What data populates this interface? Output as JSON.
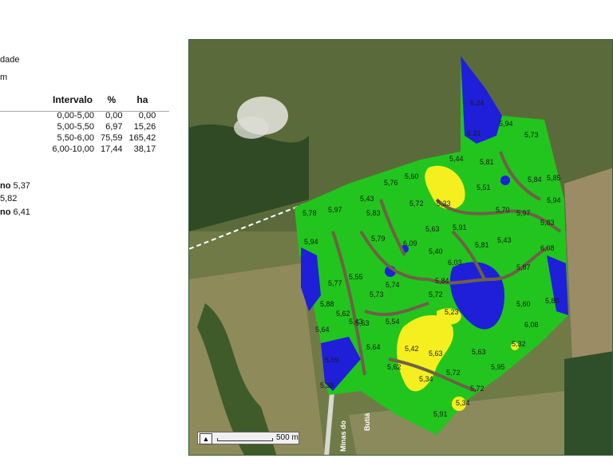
{
  "header": {
    "title_fragment": "dade",
    "unit_fragment": "m"
  },
  "legend": {
    "columns": [
      "Intervalo",
      "%",
      "ha"
    ],
    "rows": [
      {
        "intervalo": "0,00-5,00",
        "pct": "0,00",
        "ha": "0,00",
        "color": "#ffffff"
      },
      {
        "intervalo": "5,00-5,50",
        "pct": "6,97",
        "ha": "15,26",
        "color": "#f5ef1f"
      },
      {
        "intervalo": "5,50-6,00",
        "pct": "75,59",
        "ha": "165,42",
        "color": "#22c51d"
      },
      {
        "intervalo": "6,00-10,00",
        "pct": "17,44",
        "ha": "38,17",
        "color": "#1f1fd9"
      }
    ]
  },
  "stats": [
    {
      "label": "no",
      "value": "5,37"
    },
    {
      "label": "",
      "value": "5,82"
    },
    {
      "label": "no",
      "value": "6,41"
    }
  ],
  "map": {
    "scale_label": "500 m",
    "road_label_1": "Minas do",
    "road_label_2": "Butiá",
    "colors": {
      "low": "#f5ef1f",
      "mid": "#22c51d",
      "high": "#1f1fd9",
      "stream": "#6e6146"
    },
    "sample_values": [
      "6,24",
      "6,31",
      "5,94",
      "5,73",
      "5,44",
      "5,81",
      "5,60",
      "5,76",
      "5,51",
      "5,84",
      "5,85",
      "5,43",
      "5,33",
      "5,72",
      "5,70",
      "5,97",
      "5,94",
      "5,78",
      "5,97",
      "5,83",
      "5,83",
      "5,91",
      "5,63",
      "5,79",
      "6,09",
      "5,40",
      "5,43",
      "6,08",
      "5,94",
      "5,81",
      "6,03",
      "5,87",
      "5,77",
      "5,55",
      "5,74",
      "5,84",
      "5,88",
      "5,73",
      "5,72",
      "5,60",
      "5,88",
      "5,62",
      "5,43",
      "5,23",
      "5,64",
      "5,63",
      "5,54",
      "6,08",
      "5,42",
      "5,63",
      "5,63",
      "5,32",
      "5,64",
      "5,62",
      "5,34",
      "5,72",
      "5,95",
      "5,72",
      "5,34",
      "5,91",
      "5,69",
      "5,38"
    ]
  }
}
